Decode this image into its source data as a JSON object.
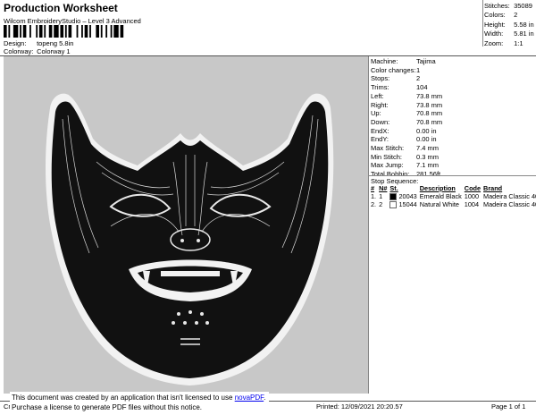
{
  "header": {
    "title": "Production Worksheet",
    "subtitle": "Wilcom EmbroideryStudio – Level 3 Advanced",
    "design_label": "Design:",
    "design_value": "topeng 5.8in",
    "colorway_label": "Colorway:",
    "colorway_value": "Colorway 1"
  },
  "stats": [
    {
      "label": "Stitches:",
      "value": "35089"
    },
    {
      "label": "Colors:",
      "value": "2"
    },
    {
      "label": "Height:",
      "value": "5.58 in"
    },
    {
      "label": "Width:",
      "value": "5.81 in"
    },
    {
      "label": "Zoom:",
      "value": "1:1"
    }
  ],
  "machine_info": [
    {
      "label": "Machine:",
      "value": "Tajima"
    },
    {
      "label": "Color changes:",
      "value": "1"
    },
    {
      "label": "Stops:",
      "value": "2"
    },
    {
      "label": "Trims:",
      "value": "104"
    },
    {
      "label": "Left:",
      "value": "73.8 mm"
    },
    {
      "label": "Right:",
      "value": "73.8 mm"
    },
    {
      "label": "Up:",
      "value": "70.8 mm"
    },
    {
      "label": "Down:",
      "value": "70.8 mm"
    },
    {
      "label": "EndX:",
      "value": "0.00 in"
    },
    {
      "label": "EndY:",
      "value": "0.00 in"
    },
    {
      "label": "Max Stitch:",
      "value": "7.4 mm"
    },
    {
      "label": "Min Stitch:",
      "value": "0.3 mm"
    },
    {
      "label": "Max Jump:",
      "value": "7.1 mm"
    },
    {
      "label": "Total Bobbin:",
      "value": "281.56ft"
    }
  ],
  "stop_sequence": {
    "title": "Stop Sequence:",
    "headers": [
      "#",
      "N#",
      "St.",
      "Description",
      "Code",
      "Brand"
    ],
    "rows": [
      {
        "num": "1.",
        "n": "1",
        "color": "#000000",
        "st": "20043",
        "desc": "Emerald Black",
        "code": "1000",
        "brand": "Madeira Classic 40"
      },
      {
        "num": "2.",
        "n": "2",
        "color": "#ffffff",
        "st": "15044",
        "desc": "Natural White",
        "code": "1004",
        "brand": "Madeira Classic 40"
      }
    ]
  },
  "footer": {
    "left": "Cr",
    "printed": "Printed: 12/09/2021 20:20.57",
    "page": "Page 1 of 1"
  },
  "notice": {
    "line1": "This document was created by an application that isn't licensed to use",
    "link": "novaPDF",
    "line1_end": ".",
    "line2": "Purchase a license to generate PDF files without this notice."
  },
  "colors": {
    "design_bg": "#c8c8c8",
    "thread_black": "#111111",
    "thread_white": "#f2f2f2"
  }
}
